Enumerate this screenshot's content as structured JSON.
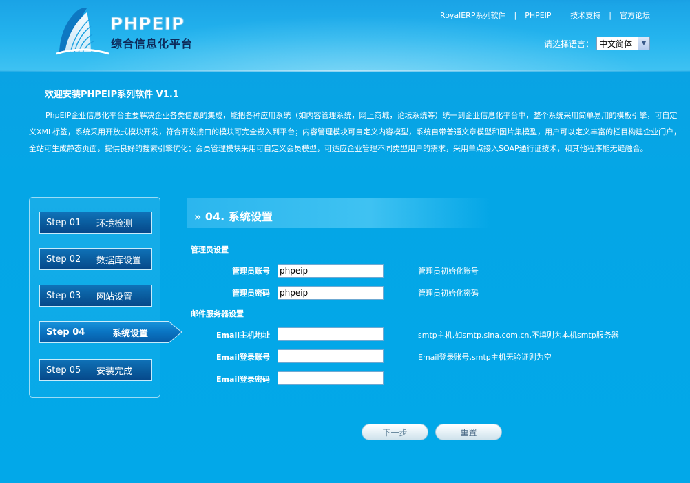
{
  "header": {
    "logo_title": "PHPEIP",
    "logo_subtitle": "综合信息化平台",
    "nav": [
      {
        "label": "RoyalERP系列软件"
      },
      {
        "label": "PHPEIP"
      },
      {
        "label": "技术支持"
      },
      {
        "label": "官方论坛"
      }
    ],
    "nav_separator": "|",
    "lang_label": "请选择语言：",
    "lang_selected": "中文简体"
  },
  "intro": {
    "welcome": "欢迎安装PHPEIP系列软件  V1.1",
    "description": "PhpEIP企业信息化平台主要解决企业各类信息的集成，能把各种应用系统（如内容管理系统，网上商城，论坛系统等）统一到企业信息化平台中，整个系统采用简单易用的模板引擎，可自定义XML标签，系统采用开放式模块开发，符合开发接口的模块可完全嵌入到平台；内容管理模块可自定义内容模型，系统自带普通文章模型和图片集模型，用户可以定义丰富的栏目构建企业门户，全站可生成静态页面，提供良好的搜索引擎优化；会员管理模块采用可自定义会员模型，可适应企业管理不同类型用户的需求，采用单点接入SOAP通行证技术，和其他程序能无缝融合。"
  },
  "steps": [
    {
      "no": "Step 01",
      "name": "环境检测",
      "active": false
    },
    {
      "no": "Step 02",
      "name": "数据库设置",
      "active": false
    },
    {
      "no": "Step 03",
      "name": "网站设置",
      "active": false
    },
    {
      "no": "Step 04",
      "name": "系统设置",
      "active": true
    },
    {
      "no": "Step 05",
      "name": "安装完成",
      "active": false
    }
  ],
  "main": {
    "title": "» 04. 系统设置",
    "admin_section": "管理员设置",
    "mail_section": "邮件服务器设置",
    "fields": {
      "admin_account": {
        "label": "管理员账号",
        "value": "phpeip",
        "hint": "管理员初始化账号"
      },
      "admin_password": {
        "label": "管理员密码",
        "value": "phpeip",
        "hint": "管理员初始化密码"
      },
      "email_host": {
        "label": "Email主机地址",
        "value": "",
        "hint": "smtp主机,如smtp.sina.com.cn,不填则为本机smtp服务器"
      },
      "email_account": {
        "label": "Email登录账号",
        "value": "",
        "hint": "Email登录账号,smtp主机无验证则为空"
      },
      "email_password": {
        "label": "Email登录密码",
        "value": "",
        "hint": ""
      }
    },
    "next_label": "下一步",
    "reset_label": "重置"
  },
  "colors": {
    "background": "#05a7e6",
    "step_bg": "#0a5d9f",
    "step_border": "#c9ecfb"
  }
}
